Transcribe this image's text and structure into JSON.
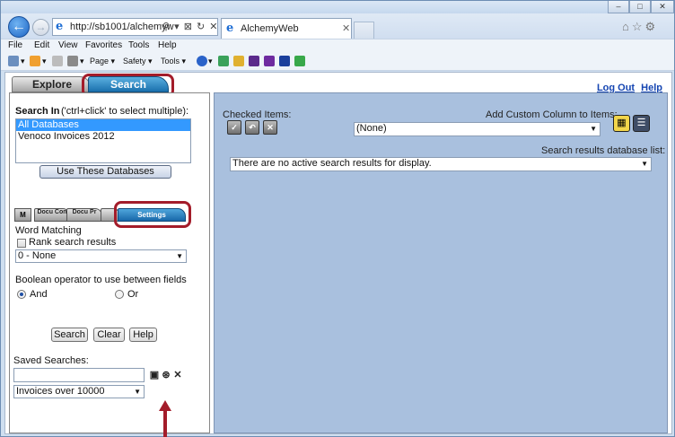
{
  "browser": {
    "url": "http://sb1001/alchemyw",
    "addr_tools": "⚲ ▾ ⊠ ↻ ✕",
    "tab_title": "AlchemyWeb",
    "tab_close": "✕",
    "back_glyph": "←",
    "fwd_glyph": "→",
    "right_icons": "⌂☆⚙",
    "win_controls": [
      "–",
      "□",
      "✕"
    ]
  },
  "menu": [
    "File",
    "Edit",
    "View",
    "Favorites",
    "Tools",
    "Help"
  ],
  "command_bar": {
    "page": "Page ▾",
    "safety": "Safety ▾",
    "tools": "Tools ▾",
    "extras": "▾"
  },
  "top_tabs": {
    "explore": "Explore",
    "search": "Search"
  },
  "top_links": {
    "logout": "Log Out",
    "help": "Help"
  },
  "left": {
    "search_in_label": "Search In",
    "search_in_hint": "('ctrl+click' to select multiple):",
    "databases": [
      "All Databases",
      "Venoco Invoices 2012"
    ],
    "selected_index": 0,
    "use_button": "Use These Databases",
    "subtabs": {
      "icon": "M",
      "doc_content": "Docu Con",
      "doc_props": "Docu Pr",
      "settings": "Settings"
    },
    "word_matching_label": "Word Matching",
    "rank_label": "Rank search results",
    "rank_checked": false,
    "word_matching_value": "0 - None",
    "boolean_label": "Boolean operator to use between fields",
    "and_label": "And",
    "or_label": "Or",
    "boolean_value": "And",
    "search_btn": "Search",
    "clear_btn": "Clear",
    "help_btn": "Help",
    "saved_label": "Saved Searches:",
    "saved_value": "Invoices over 10000",
    "saved_icons": [
      "save-icon",
      "find-icon",
      "delete-icon"
    ]
  },
  "right": {
    "checked_label": "Checked Items:",
    "checked_icons": [
      "check-all-icon",
      "uncheck-icon",
      "clear-icon"
    ],
    "custom_col_label": "Add Custom Column to Items:",
    "custom_col_value": "(None)",
    "results_list_label": "Search results database list:",
    "results_value": "There are no active search results for display."
  },
  "colors": {
    "accent_tab": "#1a70ad",
    "highlight": "#a31c2a",
    "right_bg": "#a9c0de",
    "selection": "#3399ff",
    "link": "#1545b2"
  }
}
